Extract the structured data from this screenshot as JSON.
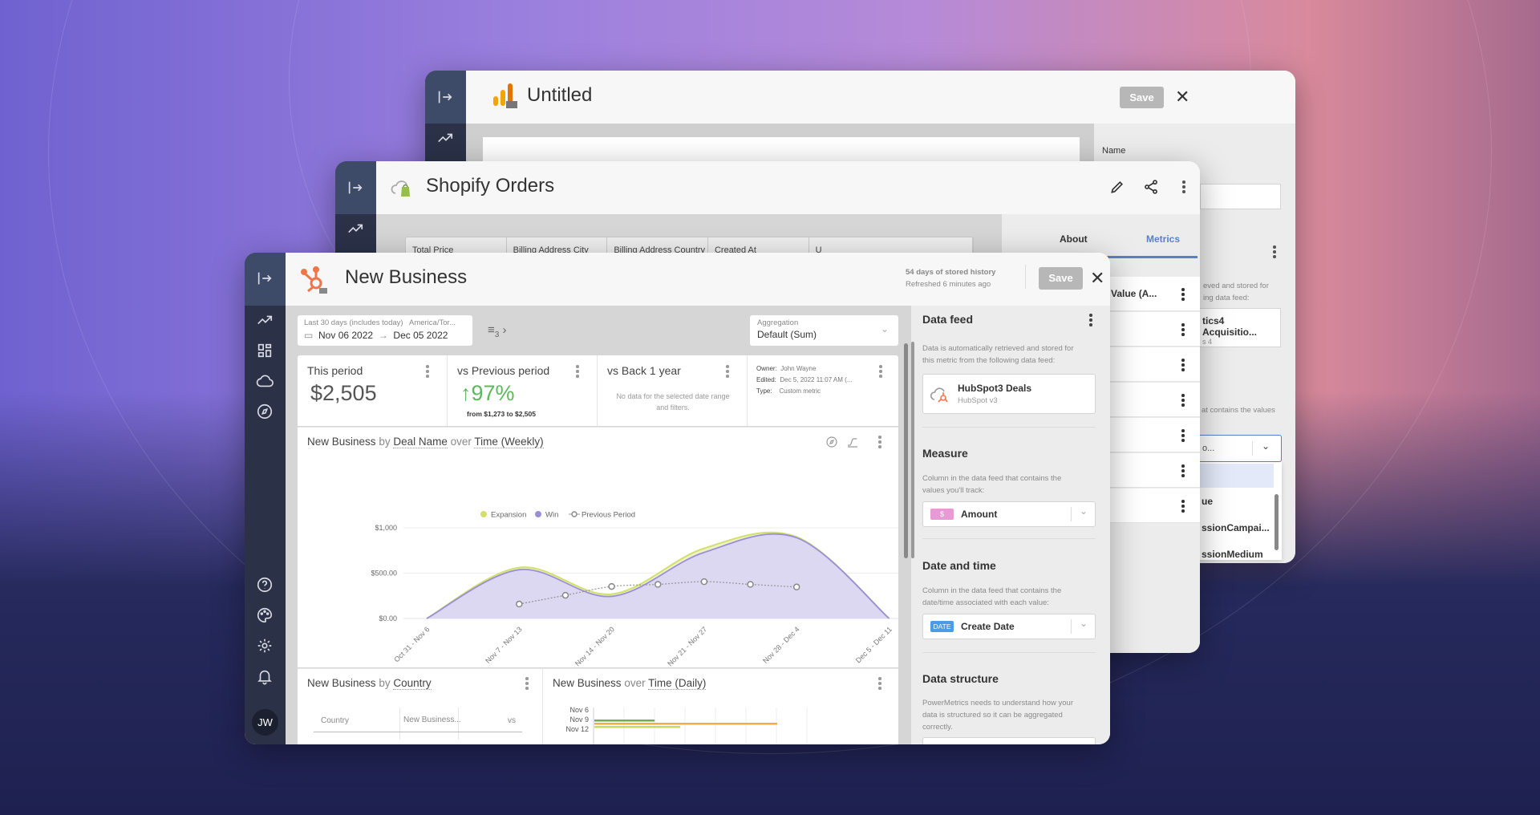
{
  "colors": {
    "accent": "#5b7fc7",
    "win": "#9a8fd6",
    "win_fill": "#dcd8f1",
    "expansion": "#d2df6a",
    "previous": "#9a9a9a",
    "positive": "#5cb85c",
    "sidebar": "#2b3248"
  },
  "untitled": {
    "title": "Untitled",
    "logo": "google-analytics-logo",
    "save_label": "Save",
    "panel": {
      "name_label": "Name",
      "desc_fragment_1": "eved and stored for",
      "desc_fragment_2": "ing data feed:",
      "feed_name": "tics4 Acquisitio...",
      "feed_sub": "s 4",
      "measure_fragment": "at contains the values",
      "select_value": "o...",
      "options": [
        "",
        "ue",
        "ssionCampai...",
        "ssionMedium"
      ]
    }
  },
  "shopify": {
    "title": "Shopify Orders",
    "icons": [
      "pencil-icon",
      "share-icon",
      "kebab-icon"
    ],
    "table_headers": [
      "Total Price",
      "Billing Address City",
      "Billing Address Country",
      "Created At",
      "U"
    ],
    "tabs": [
      {
        "label": "About",
        "active": false
      },
      {
        "label": "Metrics",
        "active": true
      }
    ],
    "rows": [
      "Value (A...",
      "",
      "",
      "",
      "",
      "",
      ""
    ]
  },
  "main": {
    "title": "New Business",
    "logo": "hubspot-logo",
    "history": "54 days of stored history",
    "refreshed": "Refreshed 6 minutes ago",
    "save_label": "Save",
    "date": {
      "preset": "Last 30 days (includes today)",
      "timezone": "America/Tor...",
      "start": "Nov 06 2022",
      "end": "Dec 05 2022"
    },
    "filter_count": "3",
    "aggregation": {
      "label": "Aggregation",
      "value": "Default (Sum)"
    },
    "kpis": [
      {
        "title": "This period",
        "value": "$2,505"
      },
      {
        "title": "vs Previous period",
        "value": "97%",
        "sub": "from $1,273 to $2,505"
      },
      {
        "title": "vs Back 1 year",
        "empty": "No data for the selected date range and filters."
      }
    ],
    "meta": {
      "owner_label": "Owner:",
      "owner": "John Wayne",
      "edited_label": "Edited:",
      "edited": "Dec 5, 2022 11:07 AM (...",
      "type_label": "Type:",
      "type": "Custom metric"
    },
    "chart_title": {
      "a": "New Business",
      "b": "by",
      "c": "Deal Name",
      "d": "over",
      "e": "Time (Weekly)"
    },
    "country_title": {
      "a": "New Business",
      "b": "by",
      "c": "Country"
    },
    "country_table": {
      "headers": [
        "Country",
        "New Business...",
        "vs"
      ]
    },
    "daily_title": {
      "a": "New Business",
      "b": "over",
      "c": "Time (Daily)"
    },
    "sidebar": {
      "avatar": "JW",
      "icons": [
        "collapse-icon",
        "trend-icon",
        "dashboard-icon",
        "cloud-icon",
        "compass-icon",
        "help-icon",
        "palette-icon",
        "gear-icon",
        "bell-icon"
      ]
    }
  },
  "panel": {
    "data_feed": {
      "title": "Data feed",
      "desc": "Data is automatically retrieved and stored for this metric from the following data feed:",
      "feed_name": "HubSpot3 Deals",
      "feed_sub": "HubSpot v3"
    },
    "measure": {
      "title": "Measure",
      "desc": "Column in the data feed that contains the values you'll track:",
      "badge": "$",
      "value": "Amount"
    },
    "datetime": {
      "title": "Date and time",
      "desc": "Column in the data feed that contains the date/time associated with each value:",
      "badge": "DATE",
      "value": "Create Date"
    },
    "structure": {
      "title": "Data structure",
      "desc": "PowerMetrics needs to understand how your data is structured so it can be aggregated correctly."
    }
  },
  "chart_data": [
    {
      "type": "area",
      "stacked": true,
      "categories": [
        "Oct 31 - Nov 6",
        "Nov 7 - Nov 13",
        "Nov 14 - Nov 20",
        "Nov 21 - Nov 27",
        "Nov 28 - Dec 4",
        "Dec 5 - Dec 11"
      ],
      "series": [
        {
          "name": "Win",
          "values": [
            0,
            538,
            244,
            729,
            891,
            0
          ]
        },
        {
          "name": "Expansion",
          "values": [
            0,
            24,
            24,
            45,
            9,
            0
          ]
        }
      ],
      "previous_period": {
        "name": "Previous Period",
        "values": [
          159,
          256,
          353,
          376,
          406,
          376,
          347
        ]
      },
      "yticks": [
        "$0.00",
        "$500.00",
        "$1,000"
      ],
      "ylim": [
        0,
        1000
      ],
      "grid": true,
      "legend": "bottom"
    },
    {
      "type": "bar",
      "orientation": "horizontal",
      "categories": [
        "Nov 6",
        "Nov 9",
        "Nov 12"
      ],
      "series": [
        {
          "values": [
            0,
            0.33,
            0.02
          ]
        },
        {
          "values": [
            0,
            1.0,
            0
          ]
        },
        {
          "values": [
            0,
            0.47,
            0
          ]
        }
      ]
    }
  ]
}
